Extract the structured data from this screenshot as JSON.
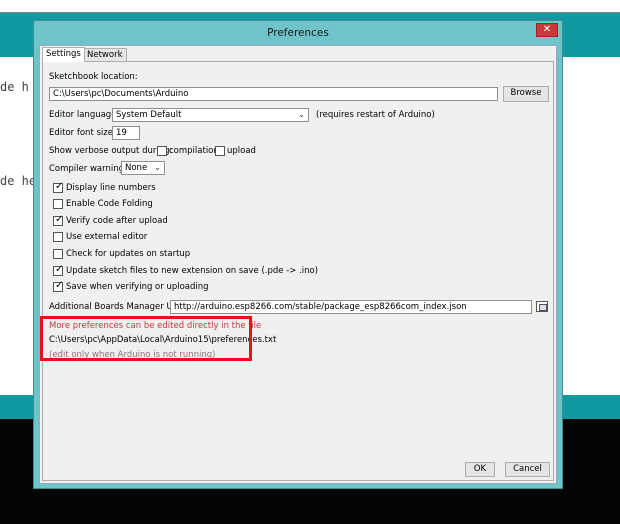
{
  "background": {
    "code_lines": [
      "de h",
      "de he"
    ]
  },
  "dialog": {
    "title": "Preferences",
    "close_glyph": "✕",
    "tabs": [
      {
        "label": "Settings",
        "active": true
      },
      {
        "label": "Network",
        "active": false
      }
    ],
    "sketchbook": {
      "label": "Sketchbook location:",
      "value": "C:\\Users\\pc\\Documents\\Arduino",
      "browse_label": "Browse"
    },
    "editor_language": {
      "label": "Editor language:",
      "value": "System Default",
      "note": "(requires restart of Arduino)"
    },
    "font_size": {
      "label": "Editor font size:",
      "value": "19"
    },
    "verbose": {
      "label": "Show verbose output during:",
      "compilation_label": "compilation",
      "upload_label": "upload",
      "compilation_checked": false,
      "upload_checked": false
    },
    "compiler_warnings": {
      "label": "Compiler warnings:",
      "value": "None"
    },
    "options": [
      {
        "label": "Display line numbers",
        "checked": true
      },
      {
        "label": "Enable Code Folding",
        "checked": false
      },
      {
        "label": "Verify code after upload",
        "checked": true
      },
      {
        "label": "Use external editor",
        "checked": false
      },
      {
        "label": "Check for updates on startup",
        "checked": false
      },
      {
        "label": "Update sketch files to new extension on save (.pde -> .ino)",
        "checked": true
      },
      {
        "label": "Save when verifying or uploading",
        "checked": true
      }
    ],
    "boards_url": {
      "label": "Additional Boards Manager URLs:",
      "value": "http://arduino.esp8266.com/stable/package_esp8266com_index.json"
    },
    "prefs_file": {
      "hint": "More preferences can be edited directly in the file",
      "path": "C:\\Users\\pc\\AppData\\Local\\Arduino15\\preferences.txt",
      "note": "(edit only when Arduino is not running)"
    },
    "ok_label": "OK",
    "cancel_label": "Cancel"
  },
  "colors": {
    "teal": "#0f9aa1",
    "dialog_frame": "#6fc4c9",
    "close": "#c8393b",
    "highlight": "#e2131a"
  }
}
